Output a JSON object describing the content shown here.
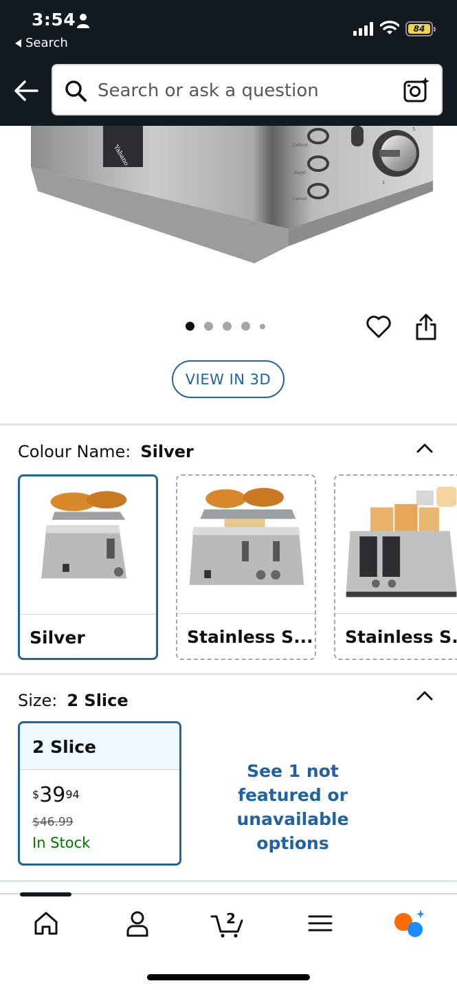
{
  "status_bar": {
    "time": "3:54",
    "back_app_label": "Search",
    "battery_level": "84"
  },
  "search": {
    "placeholder": "Search or ask a question"
  },
  "gallery": {
    "image_count": 5,
    "active_index": 0,
    "view_3d_label": "VIEW IN 3D"
  },
  "colour": {
    "label": "Colour Name:",
    "selected_value": "Silver",
    "options": [
      {
        "name": "Silver",
        "selected": true
      },
      {
        "name": "Stainless S...",
        "selected": false
      },
      {
        "name": "Stainless S...",
        "selected": false
      }
    ]
  },
  "size": {
    "label": "Size:",
    "selected_value": "2 Slice",
    "option": {
      "name": "2 Slice",
      "price_symbol": "$",
      "price_whole": "39",
      "price_fraction": "94",
      "list_price": "$46.99",
      "availability": "In Stock"
    },
    "more_options": "See 1 not featured or unavailable options"
  },
  "bottom_nav": {
    "cart_count": "2",
    "items": [
      "home-icon",
      "account-icon",
      "cart-icon",
      "menu-icon",
      "rufus-ai-icon"
    ]
  },
  "colors": {
    "header_bg": "#131921",
    "link_blue": "#2162a1",
    "in_stock_green": "#007600",
    "selected_bg": "#edf8ff"
  }
}
